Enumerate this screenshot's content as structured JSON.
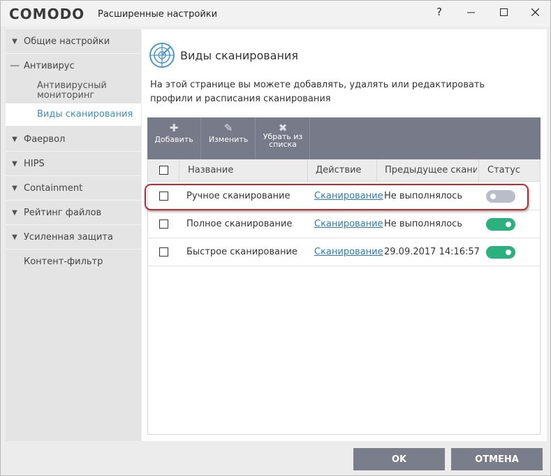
{
  "window": {
    "logo": "COMODO",
    "title": "Расширенные настройки",
    "controls": {
      "help": "?",
      "minimize": "—",
      "maximize": "☐",
      "close": "✕"
    }
  },
  "sidebar": {
    "items": [
      {
        "label": "Общие настройки",
        "expanded": false
      },
      {
        "label": "Антивирус",
        "expanded": true
      },
      {
        "label": "Антивирусный мониторинг",
        "sub": true
      },
      {
        "label": "Виды сканирования",
        "sub": true,
        "active": true
      },
      {
        "label": "Фаервол",
        "expanded": false
      },
      {
        "label": "HIPS",
        "expanded": false
      },
      {
        "label": "Containment",
        "expanded": false
      },
      {
        "label": "Рейтинг файлов",
        "expanded": false
      },
      {
        "label": "Усиленная защита",
        "expanded": false
      },
      {
        "label": "Контент-фильтр"
      }
    ],
    "sub_monitor_line1": "Антивирусный",
    "sub_monitor_line2": "мониторинг"
  },
  "main": {
    "title": "Виды сканирования",
    "description": "На этой странице вы можете добавлять, удалять или редактировать профили и расписания сканирования",
    "toolbar": {
      "add": "Добавить",
      "edit": "Изменить",
      "remove_line1": "Убрать из",
      "remove_line2": "списка"
    },
    "columns": {
      "name": "Название",
      "action": "Действие",
      "previous": "Предыдущее скани...",
      "status": "Статус"
    },
    "rows": [
      {
        "name": "Ручное сканирование",
        "action": "Сканирование",
        "previous": "Не выполнялось",
        "enabled": false
      },
      {
        "name": "Полное сканирование",
        "action": "Сканирование",
        "previous": "Не выполнялось",
        "enabled": true
      },
      {
        "name": "Быстрое сканирование",
        "action": "Сканирование",
        "previous": "29.09.2017 14:16:57",
        "enabled": true
      }
    ]
  },
  "footer": {
    "ok": "OK",
    "cancel": "ОТМЕНА"
  },
  "colors": {
    "accent": "#3a8fc9",
    "toggle_on": "#2bb080",
    "toggle_off": "#b9bcc9",
    "toolbar": "#767a89",
    "highlight": "#c1272d"
  }
}
